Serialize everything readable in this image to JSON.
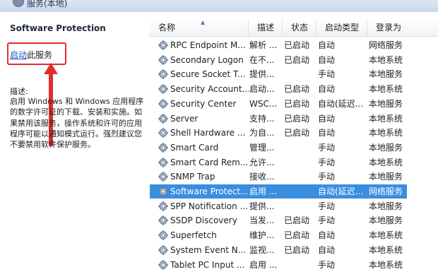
{
  "window": {
    "title": "服务(本地)"
  },
  "left_pane": {
    "service_name": "Software Protection",
    "start_link": "启动",
    "start_suffix": "此服务",
    "description_label": "描述:",
    "description": "启用 Windows 和 Windows 应用程序的数字许可证的下载、安装和实施。如果禁用该服务，操作系统和许可的应用程序可能以通知模式运行。强烈建议您不要禁用软件保护服务。"
  },
  "columns": [
    "名称",
    "描述",
    "状态",
    "启动类型",
    "登录为"
  ],
  "services": [
    {
      "name": "RPC Endpoint M...",
      "desc": "解析 ...",
      "state": "已启动",
      "startup": "自动",
      "logon": "网络服务"
    },
    {
      "name": "Secondary Logon",
      "desc": "在不...",
      "state": "已启动",
      "startup": "自动",
      "logon": "本地系统"
    },
    {
      "name": "Secure Socket T...",
      "desc": "提供...",
      "state": "",
      "startup": "手动",
      "logon": "本地服务"
    },
    {
      "name": "Security Account...",
      "desc": "启动...",
      "state": "已启动",
      "startup": "自动",
      "logon": "本地系统"
    },
    {
      "name": "Security Center",
      "desc": "WSC...",
      "state": "已启动",
      "startup": "自动(延迟...",
      "logon": "本地服务"
    },
    {
      "name": "Server",
      "desc": "支持...",
      "state": "已启动",
      "startup": "自动",
      "logon": "本地系统"
    },
    {
      "name": "Shell Hardware ...",
      "desc": "为自...",
      "state": "已启动",
      "startup": "自动",
      "logon": "本地系统"
    },
    {
      "name": "Smart Card",
      "desc": "管理...",
      "state": "",
      "startup": "手动",
      "logon": "本地服务"
    },
    {
      "name": "Smart Card Rem...",
      "desc": "允许...",
      "state": "",
      "startup": "手动",
      "logon": "本地系统"
    },
    {
      "name": "SNMP Trap",
      "desc": "接收...",
      "state": "",
      "startup": "手动",
      "logon": "本地服务"
    },
    {
      "name": "Software Protect...",
      "desc": "启用 ...",
      "state": "",
      "startup": "自动(延迟...",
      "logon": "网络服务",
      "selected": true
    },
    {
      "name": "SPP Notification ...",
      "desc": "提供...",
      "state": "",
      "startup": "手动",
      "logon": "本地服务"
    },
    {
      "name": "SSDP Discovery",
      "desc": "当发...",
      "state": "已启动",
      "startup": "手动",
      "logon": "本地服务"
    },
    {
      "name": "Superfetch",
      "desc": "维护...",
      "state": "已启动",
      "startup": "自动",
      "logon": "本地系统"
    },
    {
      "name": "System Event N...",
      "desc": "监视...",
      "state": "已启动",
      "startup": "自动",
      "logon": "本地系统"
    },
    {
      "name": "Tablet PC Input ...",
      "desc": "启用 ...",
      "state": "",
      "startup": "手动",
      "logon": "本地系统"
    }
  ],
  "colors": {
    "selection": "#3a8ee0",
    "annotation_red": "#e32b2b",
    "link": "#1a53c5"
  }
}
